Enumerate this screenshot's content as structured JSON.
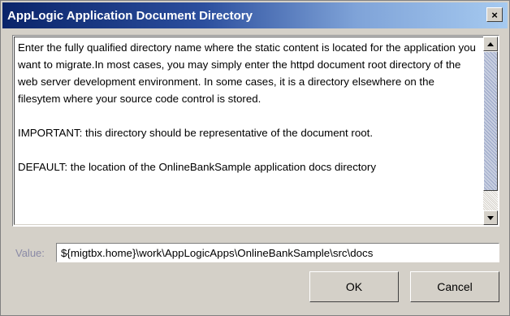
{
  "window": {
    "title": "AppLogic Application Document Directory",
    "close_glyph": "×"
  },
  "description": {
    "paragraph1": "Enter the fully qualified directory name where the static content is located for the application you want to migrate.In most cases, you may simply enter the httpd document root directory of the web server development environment.  In some cases, it is a directory elsewhere on the filesytem where your source code control is stored.",
    "paragraph2": "IMPORTANT: this directory should be representative of the document root.",
    "paragraph3": "DEFAULT: the location of the OnlineBankSample application docs directory"
  },
  "value_field": {
    "label": "Value:",
    "value": "${migtbx.home}\\work\\AppLogicApps\\OnlineBankSample\\src\\docs"
  },
  "buttons": {
    "ok": "OK",
    "cancel": "Cancel"
  },
  "icons": {
    "close": "close-icon",
    "scroll_up": "arrow-up-icon",
    "scroll_down": "arrow-down-icon"
  },
  "colors": {
    "titlebar_start": "#0a246a",
    "titlebar_end": "#a6caf0",
    "dialog_bg": "#d4d0c8"
  }
}
